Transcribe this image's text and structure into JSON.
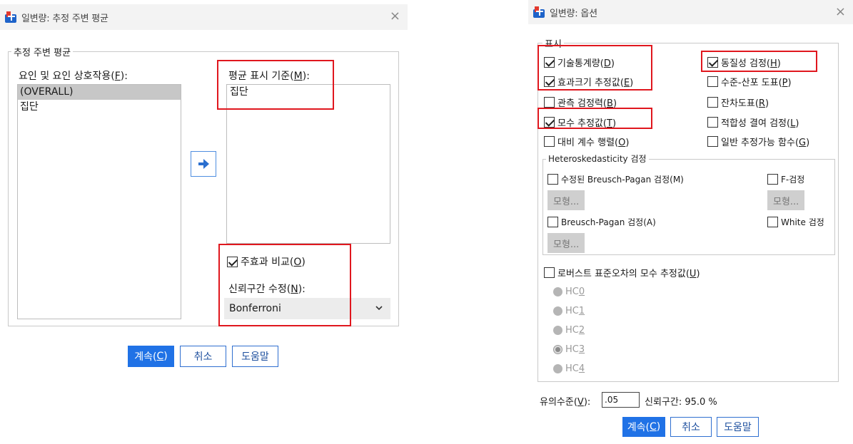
{
  "left_dialog": {
    "title": "일변량: 추정 주변 평균",
    "close_glyph": "×",
    "group_legend": "추정 주변 평균",
    "factors_label_pre": "요인 및 요인 상호작용(",
    "factors_label_key": "F",
    "factors_label_post": "):",
    "factors": [
      "(OVERALL)",
      "집단"
    ],
    "means_label_pre": "평균 표시 기준(",
    "means_label_key": "M",
    "means_label_post": "):",
    "means_items": [
      "집단"
    ],
    "compare_main_pre": "주효과 비교(",
    "compare_main_key": "O",
    "compare_main_post": ")",
    "ci_adjust_pre": "신뢰구간 수정(",
    "ci_adjust_key": "N",
    "ci_adjust_post": "):",
    "ci_adjust_value": "Bonferroni",
    "buttons": {
      "continue_pre": "계속(",
      "continue_key": "C",
      "continue_post": ")",
      "cancel": "취소",
      "help": "도움말"
    }
  },
  "right_dialog": {
    "title": "일변량: 옵션",
    "close_glyph": "×",
    "display_legend": "표시",
    "display_options": {
      "descriptive": {
        "pre": "기술통계량(",
        "key": "D",
        "post": ")",
        "checked": true
      },
      "effect_size": {
        "pre": "효과크기 추정값(",
        "key": "E",
        "post": ")",
        "checked": true
      },
      "observed_power": {
        "pre": "관측 검정력(",
        "key": "B",
        "post": ")",
        "checked": false
      },
      "parameter_estimates": {
        "pre": "모수 추정값(",
        "key": "T",
        "post": ")",
        "checked": true
      },
      "contrast_matrix": {
        "pre": "대비 계수 행렬(",
        "key": "O",
        "post": ")",
        "checked": false
      },
      "homogeneity": {
        "pre": "동질성 검정(",
        "key": "H",
        "post": ")",
        "checked": true
      },
      "spread_level": {
        "pre": "수준-산포 도표(",
        "key": "P",
        "post": ")",
        "checked": false
      },
      "residual_plot": {
        "pre": "잔차도표(",
        "key": "R",
        "post": ")",
        "checked": false
      },
      "lack_of_fit": {
        "pre": "적합성 결여 검정(",
        "key": "L",
        "post": ")",
        "checked": false
      },
      "general_estimable": {
        "pre": "일반 추정가능 함수(",
        "key": "G",
        "post": ")",
        "checked": false
      }
    },
    "hetero_legend": "Heteroskedasticity 검정",
    "hetero": {
      "mod_bp": "수정된 Breusch-Pagan 검정(M)",
      "f_test": "F-검정",
      "bp": "Breusch-Pagan 검정(A)",
      "white": "White 검정",
      "model_btn": "모형..."
    },
    "robust": {
      "pre": "로버스트 표준오차의 모수 추정값(",
      "key": "U",
      "post": ")",
      "checked": false
    },
    "hc_options": [
      {
        "pre": "HC",
        "key": "0"
      },
      {
        "pre": "HC",
        "key": "1"
      },
      {
        "pre": "HC",
        "key": "2"
      },
      {
        "pre": "HC",
        "key": "3"
      },
      {
        "pre": "HC",
        "key": "4"
      }
    ],
    "hc_selected_index": 3,
    "significance_pre": "유의수준(",
    "significance_key": "V",
    "significance_post": "):",
    "significance_value": ".05",
    "ci_text": "신뢰구간: 95.0 %",
    "buttons": {
      "continue_pre": "계속(",
      "continue_key": "C",
      "continue_post": ")",
      "cancel": "취소",
      "help": "도움말"
    }
  },
  "colors": {
    "highlight_red": "#e0171e",
    "primary_blue": "#2072e6",
    "selected_gray": "#c7c7c7"
  }
}
